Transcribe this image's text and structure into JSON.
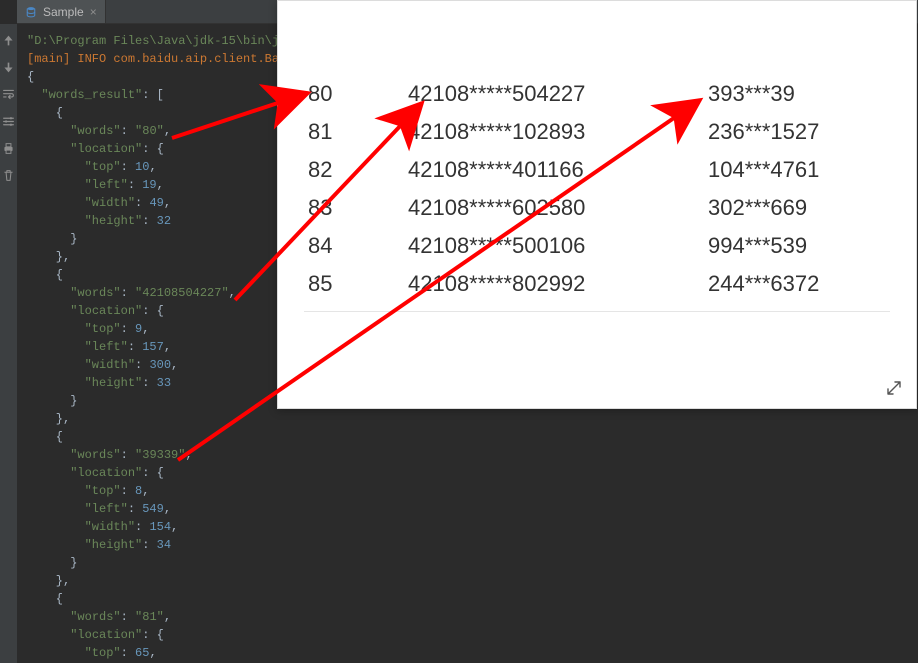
{
  "tab": {
    "title": "Sample"
  },
  "console": {
    "path_line": "\"D:\\Program Files\\Java\\jdk-15\\bin\\j",
    "log_line": "[main] INFO com.baidu.aip.client.Ba",
    "json_text": "{\n  \"words_result\": [\n    {\n      \"words\": \"80\",\n      \"location\": {\n        \"top\": 10,\n        \"left\": 19,\n        \"width\": 49,\n        \"height\": 32\n      }\n    },\n    {\n      \"words\": \"42108504227\",\n      \"location\": {\n        \"top\": 9,\n        \"left\": 157,\n        \"width\": 300,\n        \"height\": 33\n      }\n    },\n    {\n      \"words\": \"39339\",\n      \"location\": {\n        \"top\": 8,\n        \"left\": 549,\n        \"width\": 154,\n        \"height\": 34\n      }\n    },\n    {\n      \"words\": \"81\",\n      \"location\": {\n        \"top\": 65,"
  },
  "preview_rows": [
    {
      "c1": "80",
      "c2": "42108*****504227",
      "c3": "393***39"
    },
    {
      "c1": "81",
      "c2": "42108*****102893",
      "c3": "236***1527"
    },
    {
      "c1": "82",
      "c2": "42108*****401166",
      "c3": "104***4761"
    },
    {
      "c1": "83",
      "c2": "42108*****602580",
      "c3": "302***669"
    },
    {
      "c1": "84",
      "c2": "42108*****500106",
      "c3": "994***539"
    },
    {
      "c1": "85",
      "c2": "42108*****802992",
      "c3": "244***6372"
    }
  ]
}
